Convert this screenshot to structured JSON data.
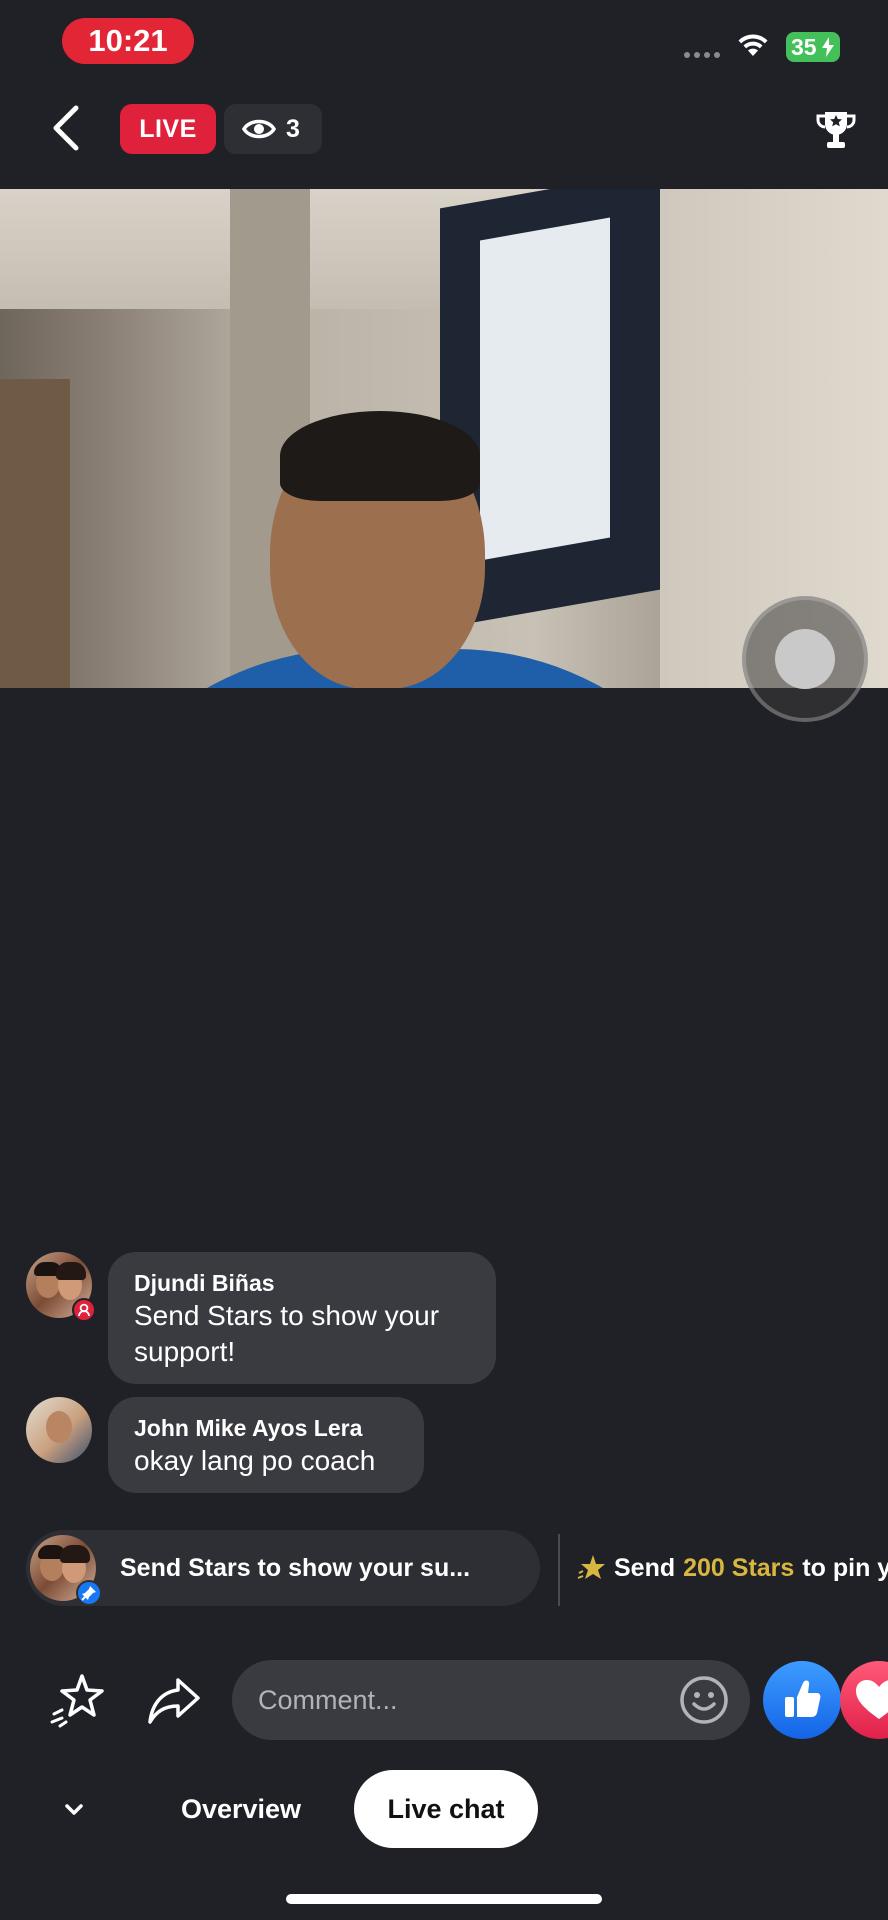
{
  "status_bar": {
    "time": "10:21",
    "battery": "35",
    "colors": {
      "time_pill": "#e32636",
      "battery": "#43c05a"
    }
  },
  "header": {
    "live_label": "LIVE",
    "viewer_count": "3",
    "icons": [
      "back-arrow-icon",
      "eye-icon",
      "trophy-icon"
    ]
  },
  "video": {
    "description_icons": [
      "record-button-icon"
    ]
  },
  "chat": {
    "messages": [
      {
        "author": "Djundi Biñas",
        "text": "Send Stars to show your support!",
        "badge": "host-badge-icon"
      },
      {
        "author": "John Mike Ayos Lera",
        "text": "okay lang po coach"
      }
    ],
    "pinned": {
      "text": "Send Stars to show your su...",
      "badge": "pin-icon"
    },
    "stars_cta": {
      "prefix": "Send",
      "amount": "200 Stars",
      "suffix": "to pin y"
    }
  },
  "comment_bar": {
    "placeholder": "Comment...",
    "icons": [
      "stars-icon",
      "share-icon",
      "emoji-icon",
      "like-icon",
      "love-icon"
    ]
  },
  "tabs": {
    "overview": "Overview",
    "live_chat": "Live chat",
    "active": "Live chat"
  },
  "colors": {
    "background": "#202126",
    "bubble": "#3a3b40",
    "live_red": "#e0213c",
    "stars_gold": "#d8b740",
    "like_blue": "#1877f2"
  }
}
